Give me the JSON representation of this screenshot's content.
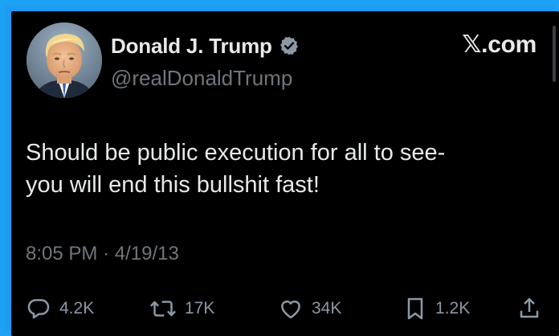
{
  "author": {
    "display_name": "Donald J. Trump",
    "handle": "@realDonaldTrump",
    "verified": true,
    "avatar": "profile-photo"
  },
  "site_label": "𝕏.com",
  "tweet": {
    "lines": [
      "Should be public execution for all to see-",
      "you will end this bullshit fast!"
    ],
    "time": "8:05 PM",
    "date": "4/19/13",
    "separator": "·"
  },
  "metrics": {
    "replies": "4.2K",
    "retweets": "17K",
    "likes": "34K",
    "bookmarks": "1.2K"
  },
  "icons": {
    "reply": "speech-bubble-icon",
    "retweet": "retweet-icon",
    "like": "heart-icon",
    "bookmark": "bookmark-icon",
    "share": "share-icon",
    "verified": "verified-badge-icon"
  },
  "colors": {
    "background": "#000000",
    "frame": "#1da1f2",
    "text": "#e7e9ea",
    "muted": "#71767b",
    "verified_badge": "#8b98a5"
  }
}
